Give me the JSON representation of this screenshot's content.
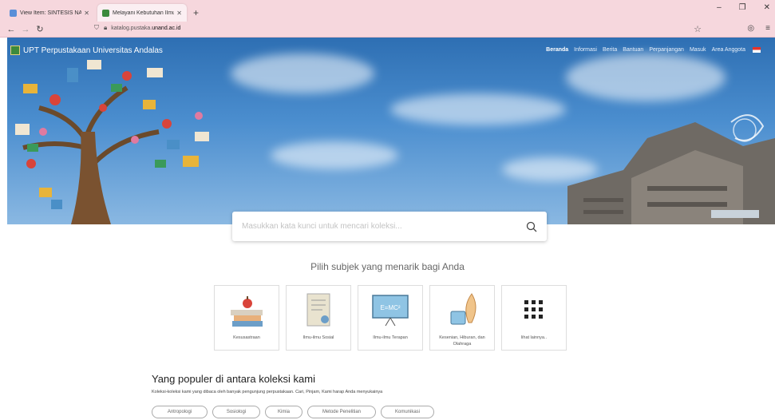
{
  "browser": {
    "tabs": [
      {
        "title": "View Item: SINTESIS NANOKO",
        "active": false
      },
      {
        "title": "Melayani Kebutuhan Ilmu deng",
        "active": true
      }
    ],
    "new_tab": "+",
    "url_prefix": "katalog.pustaka.",
    "url_domain": "unand.ac.id"
  },
  "site": {
    "name": "UPT Perpustakaan Universitas Andalas",
    "menu": [
      "Beranda",
      "Informasi",
      "Berita",
      "Bantuan",
      "Perpanjangan",
      "Masuk",
      "Area Anggota"
    ]
  },
  "search": {
    "placeholder": "Masukkan kata kunci untuk mencari koleksi..."
  },
  "subjects": {
    "title": "Pilih subjek yang menarik bagi Anda",
    "items": [
      {
        "label": "Kesusastraan",
        "icon": "books-apple-icon"
      },
      {
        "label": "Ilmu-ilmu Sosial",
        "icon": "certificate-icon"
      },
      {
        "label": "Ilmu-ilmu Terapan",
        "icon": "blackboard-icon"
      },
      {
        "label": "Kesenian, Hiburan, dan Olahraga",
        "icon": "ink-feather-icon"
      },
      {
        "label": "lihat lainnya..",
        "icon": "grid-dots-icon"
      }
    ]
  },
  "popular": {
    "title": "Yang populer di antara koleksi kami",
    "description": "Koleksi-koleksi kami yang dibaca oleh banyak pengunjung perpustakaan. Cari, Pinjam, Kami harap Anda menyukainya",
    "tags": [
      "Antropologi",
      "Sosiologi",
      "Kimia",
      "Metode Penelitian",
      "Komunikasi"
    ]
  },
  "colors": {
    "chrome": "#f6d7dd",
    "sky": "#4b8ecf"
  }
}
